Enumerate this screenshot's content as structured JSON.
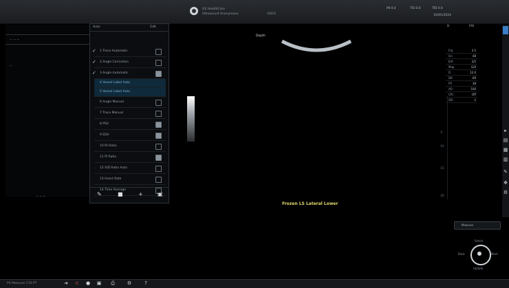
{
  "header": {
    "line1": "GE HealthCare",
    "line2": "Ultrasound Anonymous",
    "extra": "ABDO",
    "right_top": [
      "MI 0.4",
      "TIS 0.0",
      "TIB 0.0"
    ],
    "right_bottom": "10/05/2024"
  },
  "left_area": {
    "rows": [
      "~ ~ ~",
      "~"
    ],
    "bottom_label": "~  ~  ~"
  },
  "panel": {
    "header_left": "Auto",
    "header_right": "Edit",
    "items": [
      {
        "label": "1 Trace Automatic",
        "checked": true,
        "toggle": false,
        "highlight": false
      },
      {
        "label": "2 Angle Correction",
        "checked": true,
        "toggle": false,
        "highlight": false
      },
      {
        "label": "3 Angle Automatic",
        "checked": true,
        "toggle": true,
        "highlight": false
      },
      {
        "label": "4 Vessel Label Auto",
        "checked": false,
        "toggle": false,
        "highlight": true
      },
      {
        "label": "5 Vessel Label Auto",
        "checked": false,
        "toggle": false,
        "highlight": true
      },
      {
        "label": "6 Angle Manual",
        "checked": false,
        "toggle": false,
        "highlight": false
      },
      {
        "label": "7 Trace Manual",
        "checked": false,
        "toggle": false,
        "highlight": false
      },
      {
        "label": "8 PSV",
        "checked": false,
        "toggle": true,
        "highlight": false
      },
      {
        "label": "9 EDV",
        "checked": false,
        "toggle": true,
        "highlight": false
      },
      {
        "label": "10 RI Ratio",
        "checked": false,
        "toggle": false,
        "highlight": false
      },
      {
        "label": "11 PI Ratio",
        "checked": false,
        "toggle": true,
        "highlight": false
      },
      {
        "label": "12 S/D Ratio Auto",
        "checked": false,
        "toggle": false,
        "highlight": false
      },
      {
        "label": "13 Heart Rate",
        "checked": false,
        "toggle": false,
        "highlight": false
      },
      {
        "label": "14 Time Average",
        "checked": false,
        "toggle": false,
        "highlight": false
      }
    ],
    "footer_icons": [
      "pencil-icon",
      "delete-icon",
      "add-icon",
      "save-icon"
    ]
  },
  "image_area": {
    "depth_label": "Depth",
    "freeze_text": "Frozen LS Lateral Lower"
  },
  "right_column": {
    "head_left": "B",
    "head_right": "PW",
    "measurements": [
      {
        "k": "Frq",
        "v": "3.5"
      },
      {
        "k": "Gn",
        "v": "48"
      },
      {
        "k": "E/A",
        "v": "2/2"
      },
      {
        "k": "Map",
        "v": "G/0"
      },
      {
        "k": "D",
        "v": "12.0"
      },
      {
        "k": "DR",
        "v": "69"
      },
      {
        "k": "FR",
        "v": "38"
      },
      {
        "k": "AO",
        "v": "100"
      },
      {
        "k": "CRI",
        "v": "Off"
      },
      {
        "k": "SRI",
        "v": "2"
      }
    ],
    "ticks": [
      "-5",
      "-10",
      "-15",
      "-20"
    ],
    "button_label": "Measure",
    "wheel_labels": {
      "top": "Select",
      "left": "Back",
      "right": "Next",
      "bottom": "Update"
    }
  },
  "colors": {
    "accent": "#3a7fc7",
    "freeze": "#e2d96e",
    "highlight": "#7fb5d9"
  },
  "bottom_bar": {
    "text": "P4 Measure C10 PT",
    "icons": [
      "arrow-icon",
      "probe-icon",
      "palette-icon",
      "save-icon",
      "print-icon",
      "settings-icon",
      "help-icon"
    ]
  }
}
